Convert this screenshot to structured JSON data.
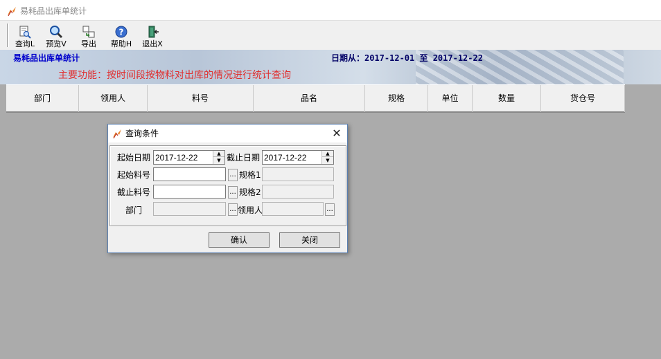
{
  "window": {
    "title": "易耗品出库单统计"
  },
  "toolbar": {
    "buttons": [
      {
        "label": "查询L",
        "icon": "query-doc-icon"
      },
      {
        "label": "预览V",
        "icon": "magnifier-icon"
      },
      {
        "label": "导出",
        "icon": "export-icon"
      },
      {
        "label": "帮助H",
        "icon": "help-icon"
      },
      {
        "label": "退出X",
        "icon": "exit-door-icon"
      }
    ]
  },
  "banner": {
    "heading": "易耗品出库单统计",
    "date_range": "日期从：2017-12-01 至 2017-12-22",
    "function_text": "主要功能：按时间段按物料对出库的情况进行统计查询"
  },
  "grid": {
    "columns": [
      "部门",
      "领用人",
      "料号",
      "品名",
      "规格",
      "单位",
      "数量",
      "货仓号"
    ]
  },
  "dialog": {
    "title": "查询条件",
    "start_date_label": "起始日期",
    "start_date_value": "2017-12-22",
    "end_date_label": "截止日期",
    "end_date_value": "2017-12-22",
    "start_item_label": "起始料号",
    "start_item_value": "",
    "spec1_label": "规格1",
    "end_item_label": "截止料号",
    "end_item_value": "",
    "spec2_label": "规格2",
    "dept_label": "部门",
    "receiver_label": "领用人",
    "ellipsis": "...",
    "confirm_label": "确认",
    "close_label": "关闭",
    "close_glyph": "✕"
  },
  "colors": {
    "heading": "#0000cc",
    "function_text": "#e03030",
    "workspace": "#ababab"
  }
}
